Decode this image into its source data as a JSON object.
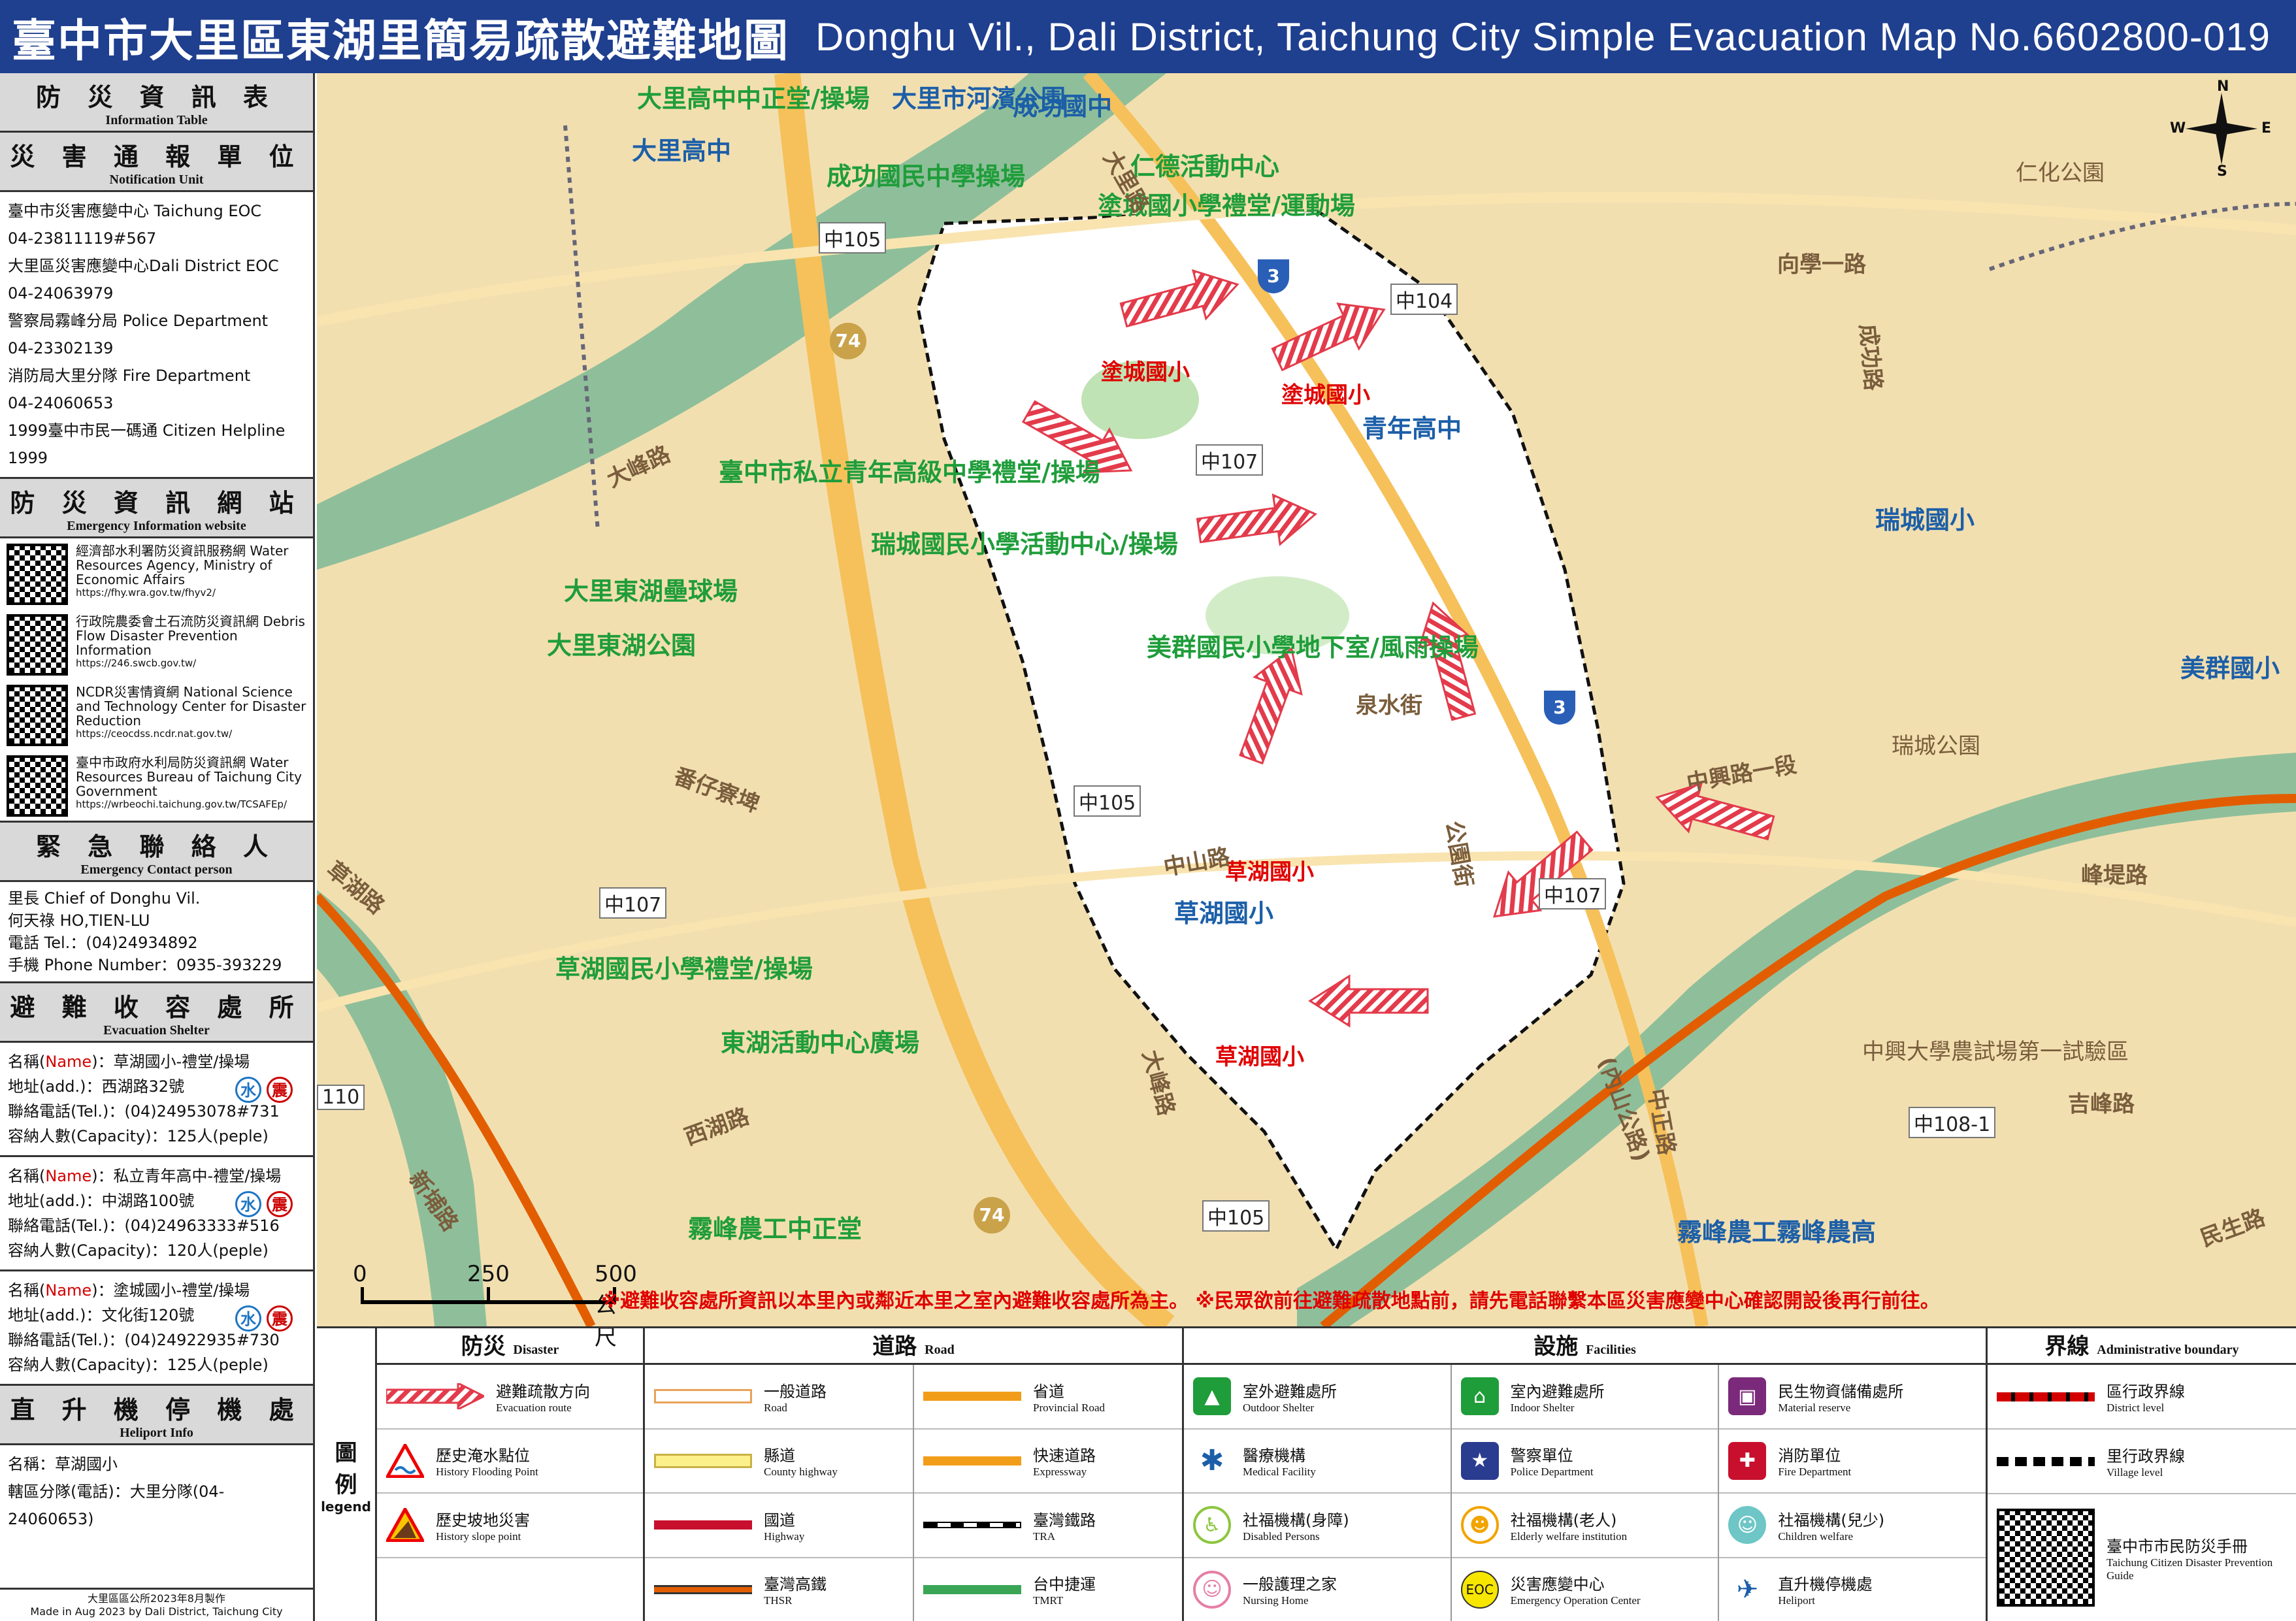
{
  "header": {
    "title_zh": "臺中市大里區東湖里簡易疏散避難地圖",
    "title_en": "Donghu Vil., Dali District, Taichung City Simple Evacuation Map No.6602800-019"
  },
  "sidebar": {
    "info_table": {
      "zh": "防 災 資 訊 表",
      "en": "Information Table"
    },
    "notification": {
      "zh": "災 害 通 報 單 位",
      "en": "Notification Unit",
      "lines": [
        "臺中市災害應變中心 Taichung EOC",
        "04-23811119#567",
        "大里區災害應變中心Dali District EOC",
        "04-24063979",
        "警察局霧峰分局 Police Department",
        "04-23302139",
        "消防局大里分隊 Fire Department",
        "04-24060653",
        "1999臺中市民一碼通 Citizen Helpline",
        "1999"
      ]
    },
    "website": {
      "zh": "防 災 資 訊 網 站",
      "en": "Emergency Information website",
      "items": [
        {
          "text": "經濟部水利署防災資訊服務網 Water Resources Agency, Ministry of Economic Affairs",
          "url": "https://fhy.wra.gov.tw/fhyv2/"
        },
        {
          "text": "行政院農委會土石流防災資訊網 Debris Flow Disaster Prevention Information",
          "url": "https://246.swcb.gov.tw/"
        },
        {
          "text": "NCDR災害情資網 National Science and Technology Center for Disaster Reduction",
          "url": "https://ceocdss.ncdr.nat.gov.tw/"
        },
        {
          "text": "臺中市政府水利局防災資訊網 Water Resources Bureau of Taichung City Government",
          "url": "https://wrbeochi.taichung.gov.tw/TCSAFEp/"
        }
      ]
    },
    "contact": {
      "zh": "緊 急 聯 絡 人",
      "en": "Emergency Contact person",
      "lines": [
        "里長 Chief of Donghu Vil.",
        "何天祿 HO,TIEN-LU",
        "電話 Tel.：(04)24934892",
        "手機 Phone Number：0935-393229"
      ]
    },
    "shelter": {
      "zh": "避 難 收 容 處 所",
      "en": "Evacuation Shelter",
      "name_label": "Name",
      "items": [
        {
          "name": "：草湖國小-禮堂/操場",
          "addr": "地址(add.)：西湖路32號",
          "tel": "聯絡電話(Tel.)：(04)24953078#731",
          "cap": "容納人數(Capacity)：125人(peple)"
        },
        {
          "name": "：私立青年高中-禮堂/操場",
          "addr": "地址(add.)：中湖路100號",
          "tel": "聯絡電話(Tel.)：(04)24963333#516",
          "cap": "容納人數(Capacity)：120人(peple)"
        },
        {
          "name": "：塗城國小-禮堂/操場",
          "addr": "地址(add.)：文化街120號",
          "tel": "聯絡電話(Tel.)：(04)24922935#730",
          "cap": "容納人數(Capacity)：125人(peple)"
        }
      ],
      "name_prefix": "名稱(",
      "name_suffix": ")",
      "badge_water": "水",
      "badge_quake": "震"
    },
    "heliport": {
      "zh": "直 升 機 停 機 處",
      "en": "Heliport Info",
      "lines": [
        "名稱：草湖國小",
        "轄區分隊(電話)：大里分隊(04-24060653)"
      ]
    },
    "footnote": [
      "大里區區公所2023年8月製作",
      "Made in Aug 2023 by Dali District, Taichung City"
    ]
  },
  "map": {
    "labels_green": [
      "大里高中中正堂/操場",
      "成功國民中學操場",
      "仁德活動中心",
      "塗城國小學禮堂/運動場",
      "臺中市私立青年高級中學禮堂/操場",
      "瑞城國民小學活動中心/操場",
      "大里東湖壘球場",
      "大里東湖公園",
      "美群國民小學地下室/風雨操場",
      "草湖國民小學禮堂/操場",
      "東湖活動中心廣場",
      "霧峰農工中正堂"
    ],
    "labels_blue": [
      "大里高中",
      "大里市河濱公園",
      "成功國中",
      "青年高中",
      "瑞城國小",
      "美群國小",
      "草湖國小",
      "霧峰農工霧峰農高"
    ],
    "labels_red": [
      "塗城國小",
      "塗城國小",
      "草湖國小",
      "草湖國小"
    ],
    "road_tags": [
      "中105",
      "中104",
      "中107",
      "中105",
      "中107",
      "中107",
      "中105",
      "中108-1",
      "110"
    ],
    "highway_tags": [
      "74",
      "74",
      "3",
      "3"
    ],
    "streets": [
      "中興路一段",
      "大里路",
      "西湖路",
      "大峰路",
      "泉水街",
      "公園街",
      "中正路",
      "(內山公路)",
      "新埔路",
      "峰堤路",
      "吉峰路",
      "民生路",
      "中山路",
      "大峰路",
      "草湖路",
      "番仔寮埤",
      "中興大學農試場第一試驗區",
      "瑞城公園",
      "仁化公園",
      "向學一路",
      "成功路"
    ],
    "note": "※避難收容處所資訊以本里內或鄰近本里之室內避難收容處所為主。 ※民眾欲前往避難疏散地點前，請先電話聯繫本區災害應變中心確認開設後再行前往。",
    "scale": {
      "n0": "0",
      "n1": "250",
      "n2": "500 公尺"
    },
    "compass": {
      "n": "N",
      "s": "S",
      "e": "E",
      "w": "W"
    },
    "colors": {
      "land": "#f2dfb0",
      "river": "#8fbf9a",
      "village": "#ffffff",
      "arrow": "#e33b4b",
      "rail": "#e25d00"
    }
  },
  "legend": {
    "title_zh": "圖\n例",
    "title_en": "legend",
    "disaster": {
      "zh": "防災",
      "en": "Disaster",
      "items": [
        {
          "zh": "避難疏散方向",
          "en": "Evacuation route",
          "icon": "arrow-icon"
        },
        {
          "zh": "歷史淹水點位",
          "en": "History Flooding Point",
          "icon": "flood-warning-icon"
        },
        {
          "zh": "歷史坡地災害",
          "en": "History slope point",
          "icon": "landslide-warning-icon"
        }
      ]
    },
    "road": {
      "zh": "道路",
      "en": "Road",
      "items": [
        {
          "zh": "一般道路",
          "en": "Road"
        },
        {
          "zh": "縣道",
          "en": "County highway"
        },
        {
          "zh": "國道",
          "en": "Highway"
        },
        {
          "zh": "臺灣高鐵",
          "en": "THSR"
        },
        {
          "zh": "省道",
          "en": "Provincial Road"
        },
        {
          "zh": "快速道路",
          "en": "Expressway"
        },
        {
          "zh": "臺灣鐵路",
          "en": "TRA"
        },
        {
          "zh": "台中捷運",
          "en": "TMRT"
        }
      ]
    },
    "facility": {
      "zh": "設施",
      "en": "Facilities",
      "items": [
        {
          "zh": "室外避難處所",
          "en": "Outdoor Shelter",
          "color": "#1f9d3a",
          "icon": "outdoor-shelter-icon"
        },
        {
          "zh": "醫療機構",
          "en": "Medical Facility",
          "color": "#1c5fa8",
          "icon": "medical-icon"
        },
        {
          "zh": "社福機構(身障)",
          "en": "Disabled Persons",
          "color": "#8cc63f",
          "icon": "disabled-icon"
        },
        {
          "zh": "一般護理之家",
          "en": "Nursing Home",
          "color": "#e67fa6",
          "icon": "nursing-home-icon"
        },
        {
          "zh": "室內避難處所",
          "en": "Indoor Shelter",
          "color": "#1f9d3a",
          "icon": "indoor-shelter-icon"
        },
        {
          "zh": "警察單位",
          "en": "Police Department",
          "color": "#2a3c8f",
          "icon": "police-icon"
        },
        {
          "zh": "社福機構(老人)",
          "en": "Elderly welfare institution",
          "color": "#f2a400",
          "icon": "elderly-icon"
        },
        {
          "zh": "災害應變中心",
          "en": "Emergency Operation Center",
          "color": "#f7e600",
          "icon": "eoc-icon",
          "glyph": "EOC"
        },
        {
          "zh": "民生物資儲備處所",
          "en": "Material reserve",
          "color": "#7b2a7b",
          "icon": "material-reserve-icon"
        },
        {
          "zh": "消防單位",
          "en": "Fire Department",
          "color": "#c8102e",
          "icon": "fire-dept-icon"
        },
        {
          "zh": "社福機構(兒少)",
          "en": "Children welfare",
          "color": "#6ec6c6",
          "icon": "children-icon"
        },
        {
          "zh": "直升機停機處",
          "en": "Heliport",
          "color": "#1c5fa8",
          "icon": "helicopter-icon"
        }
      ]
    },
    "boundary": {
      "zh": "界線",
      "en": "Administrative boundary",
      "items": [
        {
          "zh": "區行政界線",
          "en": "District level"
        },
        {
          "zh": "里行政界線",
          "en": "Village level"
        },
        {
          "zh": "臺中市市民防災手冊",
          "en": "Taichung Citizen Disaster Prevention Guide"
        }
      ]
    }
  }
}
